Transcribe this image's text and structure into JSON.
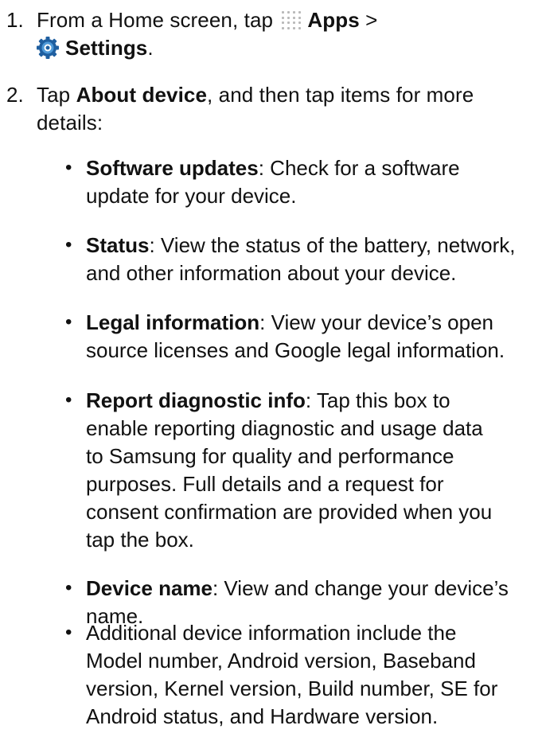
{
  "steps": [
    {
      "number": "1.",
      "prefix": "From a Home screen, tap",
      "apps_label": "Apps",
      "separator": ">",
      "settings_label": "Settings",
      "period": "."
    },
    {
      "number": "2.",
      "lead": "Tap",
      "about_label": "About device",
      "rest_line1": ", and then tap items for more",
      "line2": "details:"
    }
  ],
  "bullets": [
    {
      "term": "Software updates",
      "lines": [
        ": Check for a software",
        "update for your device."
      ]
    },
    {
      "term": "Status",
      "lines": [
        ": View the status of the battery, network,",
        "and other information about your device."
      ]
    },
    {
      "term": "Legal information",
      "lines": [
        ": View your device’s open",
        "source licenses and Google legal information."
      ]
    },
    {
      "term": "Report diagnostic info",
      "lines": [
        ": Tap this box to",
        "enable reporting diagnostic and usage data",
        "to Samsung for quality and performance",
        "purposes. Full details and a request for",
        "consent confirmation are provided when you",
        "tap the box."
      ]
    },
    {
      "term": "Device name",
      "lines": [
        ": View and change your device’s",
        "name."
      ]
    },
    {
      "term": "",
      "lines": [
        "Additional device information include the",
        "Model number, Android version, Baseband",
        "version, Kernel version, Build number, SE for",
        "Android status, and Hardware version."
      ]
    }
  ],
  "bullet_glyph": "•",
  "icons": {
    "apps": "apps-grid-icon",
    "settings": "settings-gear-icon"
  },
  "colors": {
    "text": "#111111",
    "apps_icon": "#b9b9b9",
    "gear_dark": "#1f5fa0",
    "gear_light": "#4f9ad8"
  }
}
